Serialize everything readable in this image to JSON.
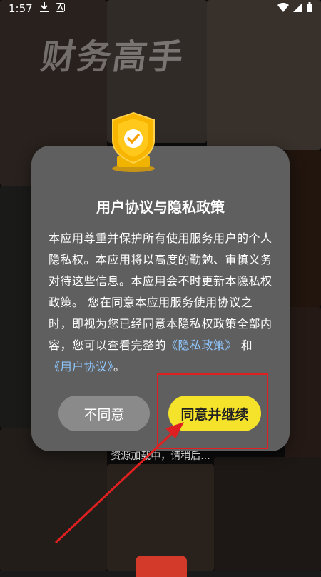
{
  "status_bar": {
    "time": "1:57",
    "icons": [
      "download-icon",
      "app-icon",
      "wifi-icon",
      "signal-icon",
      "battery-icon"
    ]
  },
  "dialog": {
    "title": "用户协议与隐私政策",
    "body_text": "本应用尊重并保护所有使用服务用户的个人隐私权。本应用将以高度的勤勉、审慎义务对待这些信息。本应用会不时更新本隐私权政策。 您在同意本应用服务使用协议之时，即视为您已经同意本隐私权政策全部内容，您可以查看完整的",
    "privacy_link": "《隐私政策》",
    "and_text": "和",
    "user_agreement_link": "《用户协议》",
    "end_text": "。",
    "decline_label": "不同意",
    "agree_label": "同意并继续"
  },
  "loading_text": "资源加载中，请稍后...",
  "background_title": "财务高手",
  "colors": {
    "dialog_bg": "#5f5f5f",
    "agree_button": "#f5e22a",
    "decline_button": "#8a8a8a",
    "link": "#8fc7ff",
    "shield": "#f7b500",
    "annotation": "#e02020"
  }
}
